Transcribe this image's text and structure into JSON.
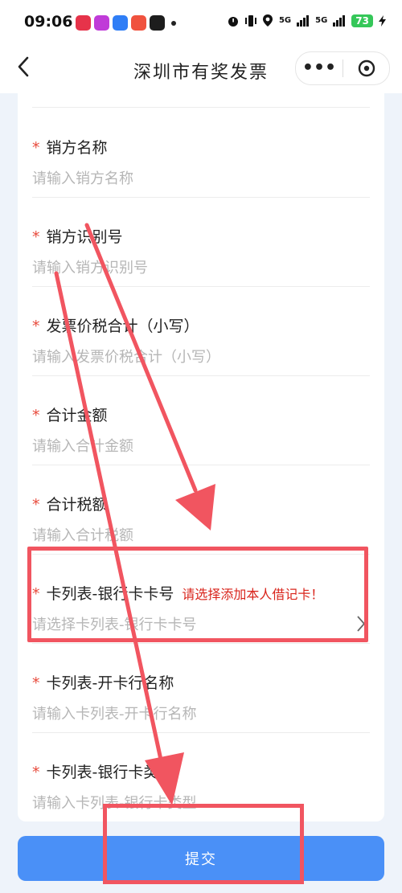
{
  "status_bar": {
    "time": "09:06",
    "network_1": "5G",
    "network_2": "5G",
    "battery": "73"
  },
  "nav": {
    "title": "深圳市有奖发票",
    "more": "•••"
  },
  "form": {
    "required_mark": "*",
    "fields": [
      {
        "label": "销方名称",
        "placeholder": "请输入销方名称"
      },
      {
        "label": "销方识别号",
        "placeholder": "请输入销方识别号"
      },
      {
        "label": "发票价税合计（小写）",
        "placeholder": "请输入发票价税合计（小写）"
      },
      {
        "label": "合计金额",
        "placeholder": "请输入合计金额"
      },
      {
        "label": "合计税额",
        "placeholder": "请输入合计税额"
      },
      {
        "label": "卡列表-银行卡卡号",
        "placeholder": "请选择卡列表-银行卡卡号",
        "warning": "请选择添加本人借记卡！"
      },
      {
        "label": "卡列表-开卡行名称",
        "placeholder": "请输入卡列表-开卡行名称"
      },
      {
        "label": "卡列表-银行卡类型",
        "placeholder": "请输入卡列表-银行卡类型"
      }
    ]
  },
  "submit": {
    "label": "提交"
  },
  "colors": {
    "accent": "#4a90f7",
    "required": "#e84a3c",
    "warning": "#d9251c",
    "annotation": "#f15560"
  }
}
